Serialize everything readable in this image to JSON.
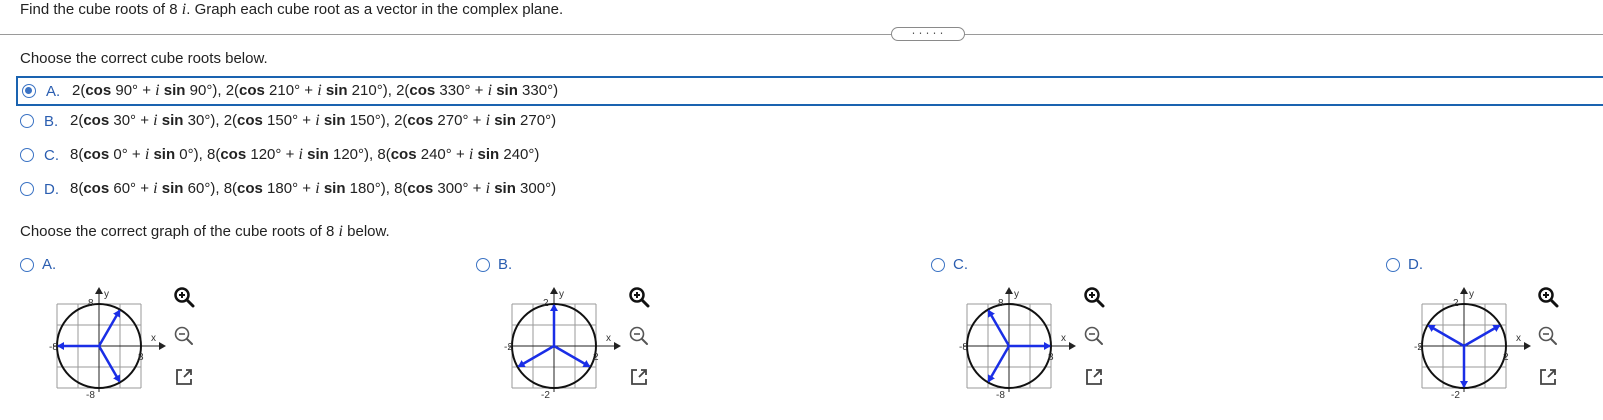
{
  "question": {
    "before": "Find the cube roots of 8",
    "i": "i",
    "after": ". Graph each cube root as a vector in the complex plane."
  },
  "divider_handle": ".....",
  "roots_prompt": "Choose the correct cube roots below.",
  "options": [
    {
      "letter": "A.",
      "selected": true,
      "terms": [
        {
          "mod": "2",
          "angle": "90"
        },
        {
          "mod": "2",
          "angle": "210"
        },
        {
          "mod": "2",
          "angle": "330"
        }
      ]
    },
    {
      "letter": "B.",
      "selected": false,
      "terms": [
        {
          "mod": "2",
          "angle": "30"
        },
        {
          "mod": "2",
          "angle": "150"
        },
        {
          "mod": "2",
          "angle": "270"
        }
      ]
    },
    {
      "letter": "C.",
      "selected": false,
      "terms": [
        {
          "mod": "8",
          "angle": "0"
        },
        {
          "mod": "8",
          "angle": "120"
        },
        {
          "mod": "8",
          "angle": "240"
        }
      ]
    },
    {
      "letter": "D.",
      "selected": false,
      "terms": [
        {
          "mod": "8",
          "angle": "60"
        },
        {
          "mod": "8",
          "angle": "180"
        },
        {
          "mod": "8",
          "angle": "300"
        }
      ]
    }
  ],
  "graph_prompt": {
    "before": "Choose the correct graph of the cube roots of 8",
    "i": "i",
    "after": " below."
  },
  "graphs": [
    {
      "letter": "A.",
      "max": "8",
      "neg": "-8",
      "angles": [
        60,
        180,
        300
      ],
      "icons": [
        "zoom-in-icon",
        "zoom-out-icon",
        "open-new-window-icon"
      ]
    },
    {
      "letter": "B.",
      "max": "2",
      "neg": "-2",
      "angles": [
        90,
        210,
        330
      ],
      "icons": [
        "zoom-in-icon",
        "zoom-out-icon",
        "open-new-window-icon"
      ]
    },
    {
      "letter": "C.",
      "max": "8",
      "neg": "-8",
      "angles": [
        0,
        120,
        240
      ],
      "icons": [
        "zoom-in-icon",
        "zoom-out-icon",
        "open-new-window-icon"
      ]
    },
    {
      "letter": "D.",
      "max": "2",
      "neg": "-2",
      "angles": [
        30,
        150,
        270
      ],
      "icons": [
        "zoom-in-icon",
        "zoom-out-icon",
        "open-new-window-icon"
      ]
    }
  ],
  "axis_labels": {
    "x": "x",
    "y": "y"
  },
  "colors": {
    "accent": "#1a63b0",
    "vector": "#1a2ee6",
    "radio": "#3b73c4"
  }
}
